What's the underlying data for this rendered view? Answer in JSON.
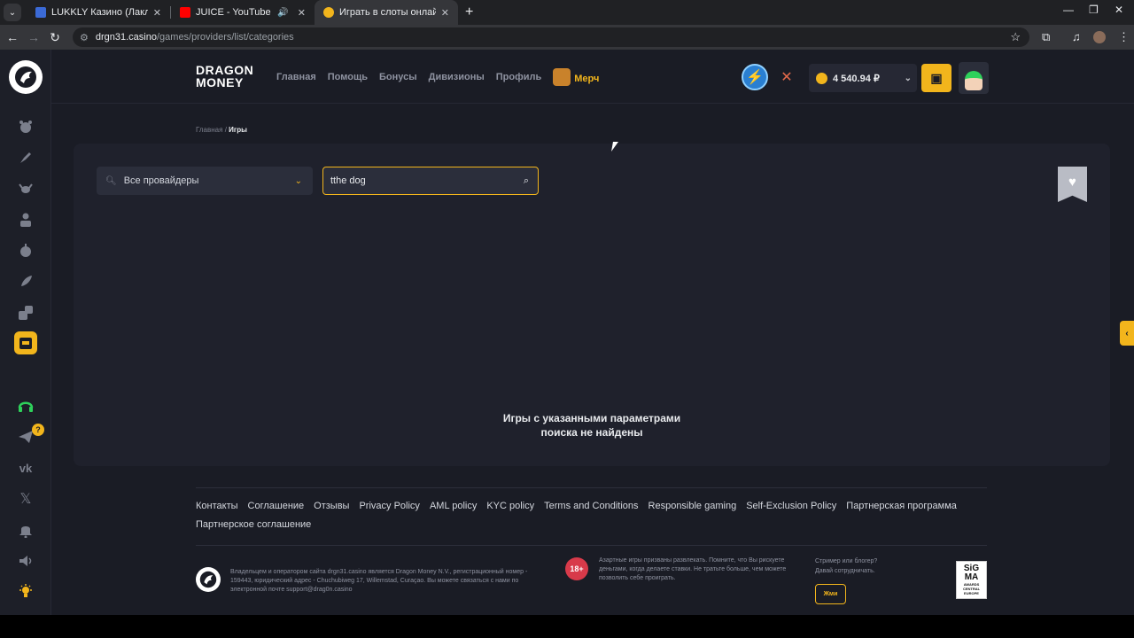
{
  "browser": {
    "tabs": [
      {
        "title": "LUKKLY Казино (Лакли) | Офиц",
        "favicon_color": "#3b6ad6"
      },
      {
        "title": "JUICE - YouTube",
        "favicon_color": "#ff0000"
      },
      {
        "title": "Играть в слоты онлайн в казин",
        "favicon_color": "#f2b51c",
        "active": true
      }
    ],
    "url_host": "drgn31.casino",
    "url_path": "/games/providers/list/categories"
  },
  "brand": {
    "line1": "DRAGON",
    "line2": "MONEY"
  },
  "menu": {
    "home": "Главная",
    "help": "Помощь",
    "bonuses": "Бонусы",
    "divisions": "Дивизионы",
    "profile": "Профиль",
    "merch": "Мерч"
  },
  "balance": {
    "amount": "4 540.94 ₽"
  },
  "breadcrumb": {
    "home": "Главная",
    "separator": "/",
    "current": "Игры"
  },
  "filters": {
    "provider_value": "Все провайдеры",
    "search_value": "tthe dog"
  },
  "results": {
    "empty_line1": "Игры с указанными параметрами",
    "empty_line2": "поиска не найдены"
  },
  "rail": {
    "notification_badge": "?"
  },
  "footer": {
    "links": [
      "Контакты",
      "Соглашение",
      "Отзывы",
      "Privacy Policy",
      "AML policy",
      "KYC policy",
      "Terms and Conditions",
      "Responsible gaming",
      "Self-Exclusion Policy",
      "Партнерская программа",
      "Партнерское соглашение"
    ],
    "owner_text": "Владельцем и оператором сайта drgn31.casino является Dragon Money N.V., регистрационный номер - 159443, юридический адрес - Chuchubiweg 17, Willemstad, Curaçao. Вы можете связаться с нами по электронной почте support@drag0n.casino",
    "age_badge": "18+",
    "warning_text": "Азартные игры призваны развлекать. Помните, что Вы рискуете деньгами, когда делаете ставки. Не тратьте больше, чем можете позволить себе проиграть.",
    "streamer_line1": "Стример или блогер?",
    "streamer_line2": "Давай сотрудничать.",
    "press_button": "Жми",
    "sigma_top": "SiG",
    "sigma_mid": "MA",
    "sigma_awards": "AWARDS",
    "sigma_region": "CENTRAL EUROPE"
  },
  "colors": {
    "accent": "#f2b51c",
    "background": "#1a1c25",
    "panel": "#1f212c"
  }
}
